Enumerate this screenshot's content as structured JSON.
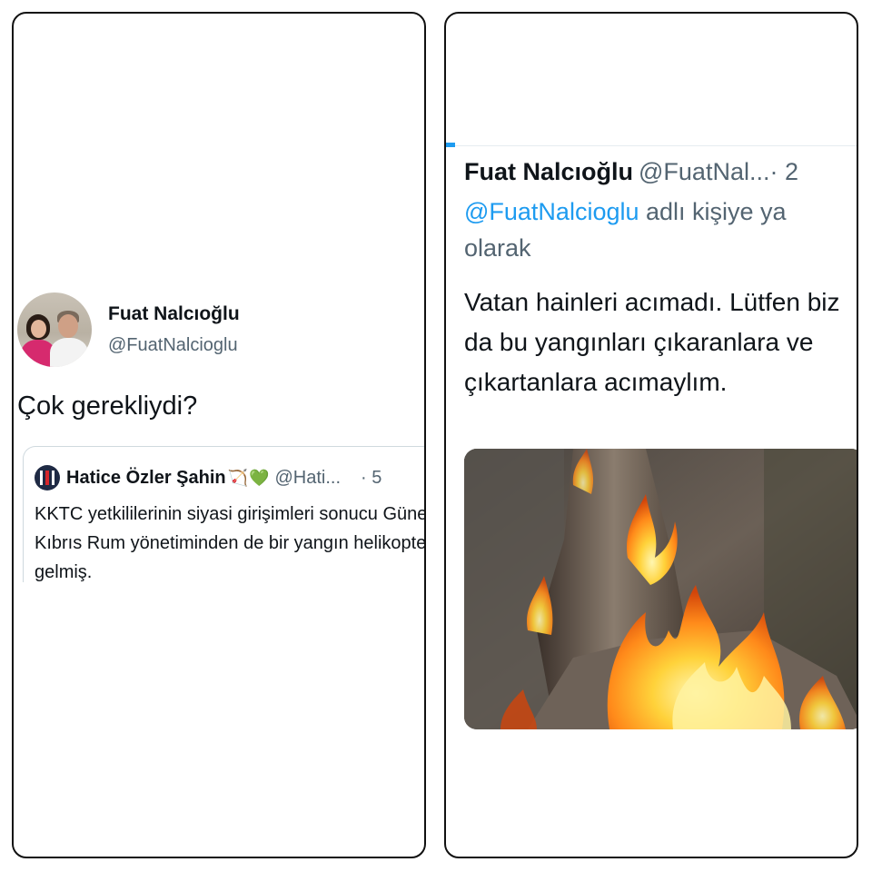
{
  "left_tweet": {
    "author_name": "Fuat Nalcıoğlu",
    "author_handle": "@FuatNalcioglu",
    "avatar_icon": "profile-photo-two-people",
    "text": "Çok gerekliydi?",
    "quote": {
      "author_name": "Hatice Özler Şahin",
      "emoji_1": "🏹",
      "emoji_2": "💚",
      "author_handle": "@Hati...",
      "time": "· 5",
      "avatar_icon": "flag-badge-icon",
      "text": "KKTC yetkililerinin siyasi girişimleri sonucu Güney Kıbrıs Rum yönetiminden de bir yangın helikopteri gelmiş."
    }
  },
  "right_tweet": {
    "author_name": "Fuat Nalcıoğlu",
    "author_handle": "@FuatNal...",
    "time": "· 2",
    "reply_mention": "@FuatNalcioglu",
    "reply_rest": " adlı kişiye ya",
    "reply_line2": "olarak",
    "text": "Vatan hainleri acımadı. Lütfen biz da bu yangınları çıkaranlara ve çıkartanlara acımaylım.",
    "image_icon": "burning-tree-stump-photo"
  },
  "colors": {
    "link_blue": "#1d9bf0",
    "muted_gray": "#536471",
    "text_black": "#0f1419"
  }
}
